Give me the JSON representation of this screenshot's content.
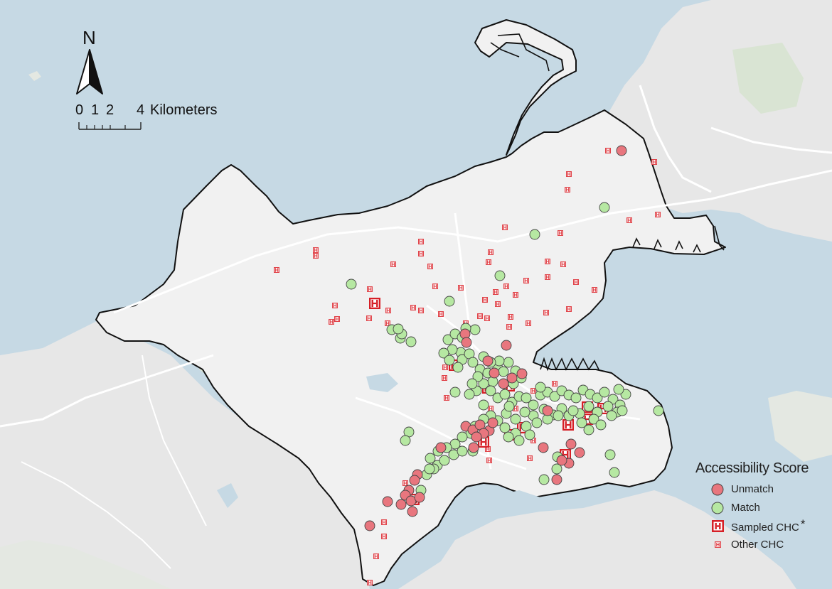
{
  "north_arrow": {
    "label": "N"
  },
  "scale_bar": {
    "ticks": [
      "0",
      "1",
      "2",
      "4"
    ],
    "unit": "Kilometers"
  },
  "legend": {
    "title": "Accessibility Score",
    "items": [
      {
        "key": "unmatch",
        "label": "Unmatch",
        "symbol": "circle",
        "color": "#e8767e"
      },
      {
        "key": "match",
        "label": "Match",
        "symbol": "circle",
        "color": "#b6e8a2"
      },
      {
        "key": "sampled",
        "label": "Sampled CHC",
        "symbol": "hospital-large",
        "color": "#d61f26",
        "note": "*"
      },
      {
        "key": "other",
        "label": "Other CHC",
        "symbol": "hospital-small",
        "color": "#e0454b"
      }
    ]
  },
  "colors": {
    "sea": "#c6d9e4",
    "land": "#e7e7e7",
    "study_area": "#f2f2f2",
    "boundary": "#111111",
    "green_space": "#d7e3d1"
  }
}
